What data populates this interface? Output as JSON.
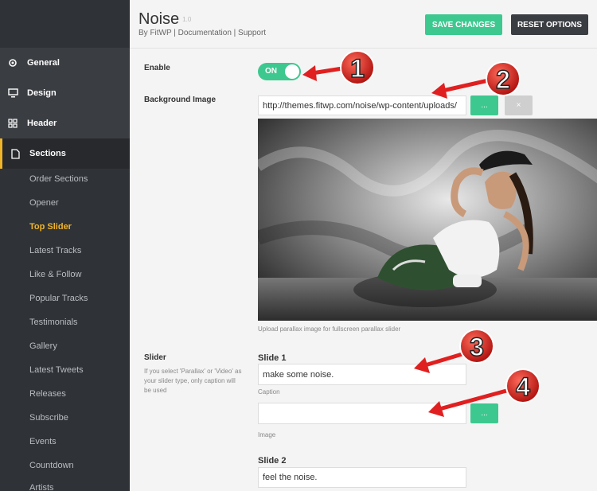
{
  "sidebar": {
    "main": [
      {
        "label": "General",
        "icon": "gear-icon"
      },
      {
        "label": "Design",
        "icon": "monitor-icon"
      },
      {
        "label": "Header",
        "icon": "grid-icon"
      },
      {
        "label": "Sections",
        "icon": "document-icon"
      }
    ],
    "sub": [
      "Order Sections",
      "Opener",
      "Top Slider",
      "Latest Tracks",
      "Like & Follow",
      "Popular Tracks",
      "Testimonials",
      "Gallery",
      "Latest Tweets",
      "Releases",
      "Subscribe",
      "Events",
      "Countdown",
      "Artists"
    ],
    "active_main": "Sections",
    "active_sub": "Top Slider",
    "accent": "#f0b429"
  },
  "header": {
    "title": "Noise",
    "version": "1.0",
    "byline": "By FitWP | Documentation | Support",
    "save_label": "SAVE CHANGES",
    "reset_label": "RESET OPTIONS"
  },
  "form": {
    "enable_label": "Enable",
    "toggle_text": "ON",
    "bg_label": "Background Image",
    "bg_url": "http://themes.fitwp.com/noise/wp-content/uploads/",
    "pick_button": "...",
    "remove_button": "×",
    "bg_help": "Upload parallax image for fullscreen parallax slider",
    "slider_label": "Slider",
    "slider_help": "If you select 'Parallax' or 'Video' as your slider type, only caption will be used",
    "slide1_title": "Slide 1",
    "slide1_caption": "make some noise.",
    "caption_label": "Caption",
    "image_label": "Image",
    "slide2_title": "Slide 2",
    "slide2_caption": "feel the noise."
  },
  "annotations": [
    "1",
    "2",
    "3",
    "4"
  ],
  "colors": {
    "green": "#3dc88f",
    "dark": "#3a3d42",
    "arrow": "#e02020"
  }
}
